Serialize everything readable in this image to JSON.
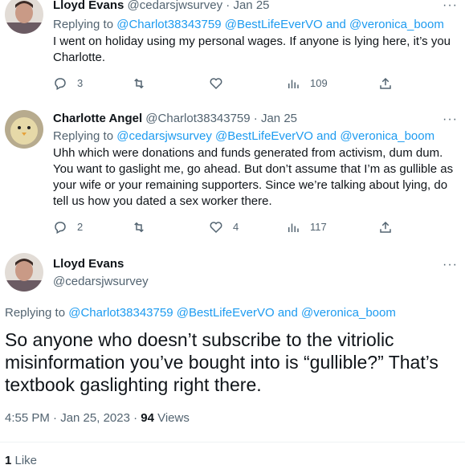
{
  "tweets": [
    {
      "name": "Lloyd Evans",
      "handle": "@cedarsjwsurvey",
      "separator": "·",
      "time": "Jan 25",
      "replying_prefix": "Replying to",
      "mentions": [
        "@Charlot38343759",
        "@BestLifeEverVO",
        "and",
        "@veronica_boom"
      ],
      "text": "I went on holiday using my personal wages. If anyone is lying here, it’s you Charlotte.",
      "actions": {
        "replies": "3",
        "retweets": "",
        "likes": "",
        "views": "109"
      }
    },
    {
      "name": "Charlotte Angel",
      "handle": "@Charlot38343759",
      "separator": "·",
      "time": "Jan 25",
      "replying_prefix": "Replying to",
      "mentions": [
        "@cedarsjwsurvey",
        "@BestLifeEverVO",
        "and",
        "@veronica_boom"
      ],
      "text": "Uhh which were donations and funds generated from activism, dum dum. You want to gaslight me, go ahead.  But don’t assume that I’m as gullible as your wife or your remaining supporters.  Since we’re talking about lying, do tell us how you dated a sex worker there.",
      "actions": {
        "replies": "2",
        "retweets": "",
        "likes": "4",
        "views": "117"
      }
    }
  ],
  "main_tweet": {
    "name": "Lloyd Evans",
    "handle": "@cedarsjwsurvey",
    "replying_prefix": "Replying to",
    "mentions": [
      "@Charlot38343759",
      "@BestLifeEverVO",
      "and",
      "@veronica_boom"
    ],
    "text": "So anyone who doesn’t subscribe to the vitriolic misinformation you’ve bought into is “gullible?” That’s textbook gaslighting right there.",
    "timestamp": "4:55 PM · Jan 25, 2023 · ",
    "views_count": "94",
    "views_label": " Views",
    "likes_count": "1",
    "likes_label": " Like"
  },
  "icons": {
    "reply": "reply-icon",
    "retweet": "retweet-icon",
    "like": "heart-icon",
    "views": "views-chart-icon",
    "share": "share-icon",
    "more": "more-icon"
  },
  "colors": {
    "accent": "#1d9bf0",
    "muted": "#536471",
    "text": "#0f1419"
  }
}
